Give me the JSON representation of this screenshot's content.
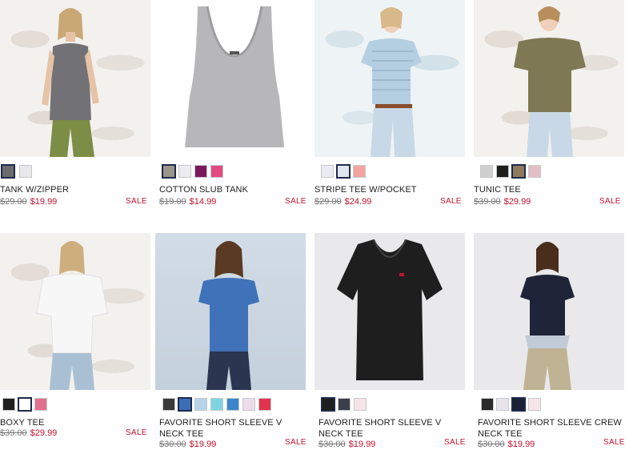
{
  "products": [
    {
      "name": "TANK W/ZIPPER",
      "was": "$29.00",
      "now": "$19.99",
      "sale": "SALE",
      "swatches": [
        "#6b6b70",
        "#e8e8ec"
      ],
      "selected": 0
    },
    {
      "name": "COTTON SLUB TANK",
      "was": "$19.00",
      "now": "$14.99",
      "sale": "SALE",
      "swatches": [
        "#9b968c",
        "#ecebf0",
        "#7a1a5c",
        "#e24a82"
      ],
      "selected": 0
    },
    {
      "name": "STRIPE TEE W/POCKET",
      "was": "$29.00",
      "now": "$24.99",
      "sale": "SALE",
      "swatches": [
        "#ebebf3",
        "#dfe6ee",
        "#f4a3a3"
      ],
      "selected": 1
    },
    {
      "name": "TUNIC TEE",
      "was": "$39.00",
      "now": "$29.99",
      "sale": "SALE",
      "swatches": [
        "#cfcfcf",
        "#1f1f1f",
        "#8e7b5e",
        "#e1bfc6"
      ],
      "selected": 2
    },
    {
      "name": "BOXY TEE",
      "was": "$39.00",
      "now": "$29.99",
      "sale": "SALE",
      "swatches": [
        "#1f1f1f",
        "#ffffff",
        "#e2708f"
      ],
      "selected": 1
    },
    {
      "name": "FAVORITE SHORT SLEEVE V NECK TEE",
      "was": "$30.00",
      "now": "$19.99",
      "sale": "SALE",
      "swatches": [
        "#3a3a3a",
        "#3b6eb8",
        "#b6d3ea",
        "#7fd4e2",
        "#3a85cc",
        "#ecdcea",
        "#e0334f"
      ],
      "selected": 1
    },
    {
      "name": "FAVORITE SHORT SLEEVE V NECK TEE",
      "was": "$30.00",
      "now": "$19.99",
      "sale": "SALE",
      "swatches": [
        "#1e1e1e",
        "#3c3f4a",
        "#f6e5e8"
      ],
      "selected": 0
    },
    {
      "name": "FAVORITE SHORT SLEEVE CREW NECK TEE",
      "was": "$30.00",
      "now": "$19.99",
      "sale": "SALE",
      "swatches": [
        "#2a2a2a",
        "#e6e4ea",
        "#1b2238",
        "#f6e5e8"
      ],
      "selected": 2
    }
  ]
}
